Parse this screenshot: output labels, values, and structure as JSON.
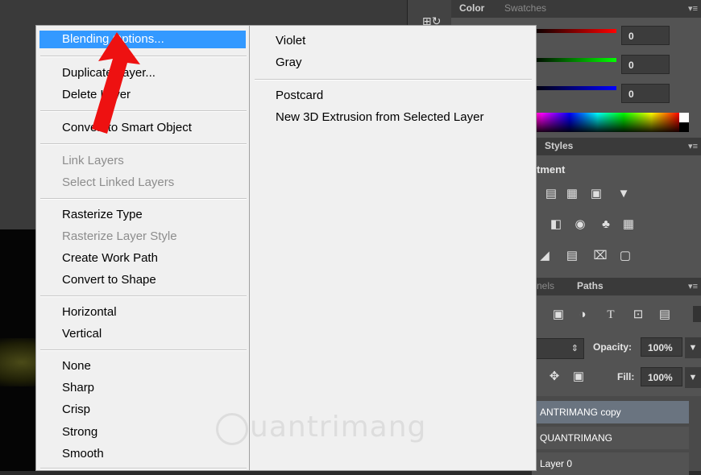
{
  "color_panel": {
    "tabs": [
      "Color",
      "Swatches"
    ],
    "red_value": "0",
    "green_value": "0",
    "blue_value": "0"
  },
  "adjust_panel": {
    "tabs": [
      "Styles"
    ],
    "title_fragment": "tment"
  },
  "layers_panel": {
    "tabs": [
      "nels",
      "Paths"
    ],
    "opacity_label": "Opacity:",
    "opacity_value": "100%",
    "fill_label": "Fill:",
    "fill_value": "100%",
    "layers": [
      "ANTRIMANG copy",
      "QUANTRIMANG",
      "Layer 0"
    ]
  },
  "context_menu": {
    "blending_options": "Blending Options...",
    "duplicate_layer": "Duplicate Layer...",
    "delete_layer": "Delete Layer",
    "convert_smart_object": "Convert to Smart Object",
    "link_layers": "Link Layers",
    "select_linked_layers": "Select Linked Layers",
    "rasterize_type": "Rasterize Type",
    "rasterize_layer_style": "Rasterize Layer Style",
    "create_work_path": "Create Work Path",
    "convert_to_shape": "Convert to Shape",
    "horizontal": "Horizontal",
    "vertical": "Vertical",
    "none": "None",
    "sharp": "Sharp",
    "crisp": "Crisp",
    "strong": "Strong",
    "smooth": "Smooth"
  },
  "submenu": {
    "violet": "Violet",
    "gray": "Gray",
    "postcard": "Postcard",
    "new_3d_extrusion": "New 3D Extrusion from Selected Layer"
  },
  "watermark": "uantrimang",
  "colors": {
    "highlight": "#3399ff",
    "arrow": "#ee1111"
  }
}
